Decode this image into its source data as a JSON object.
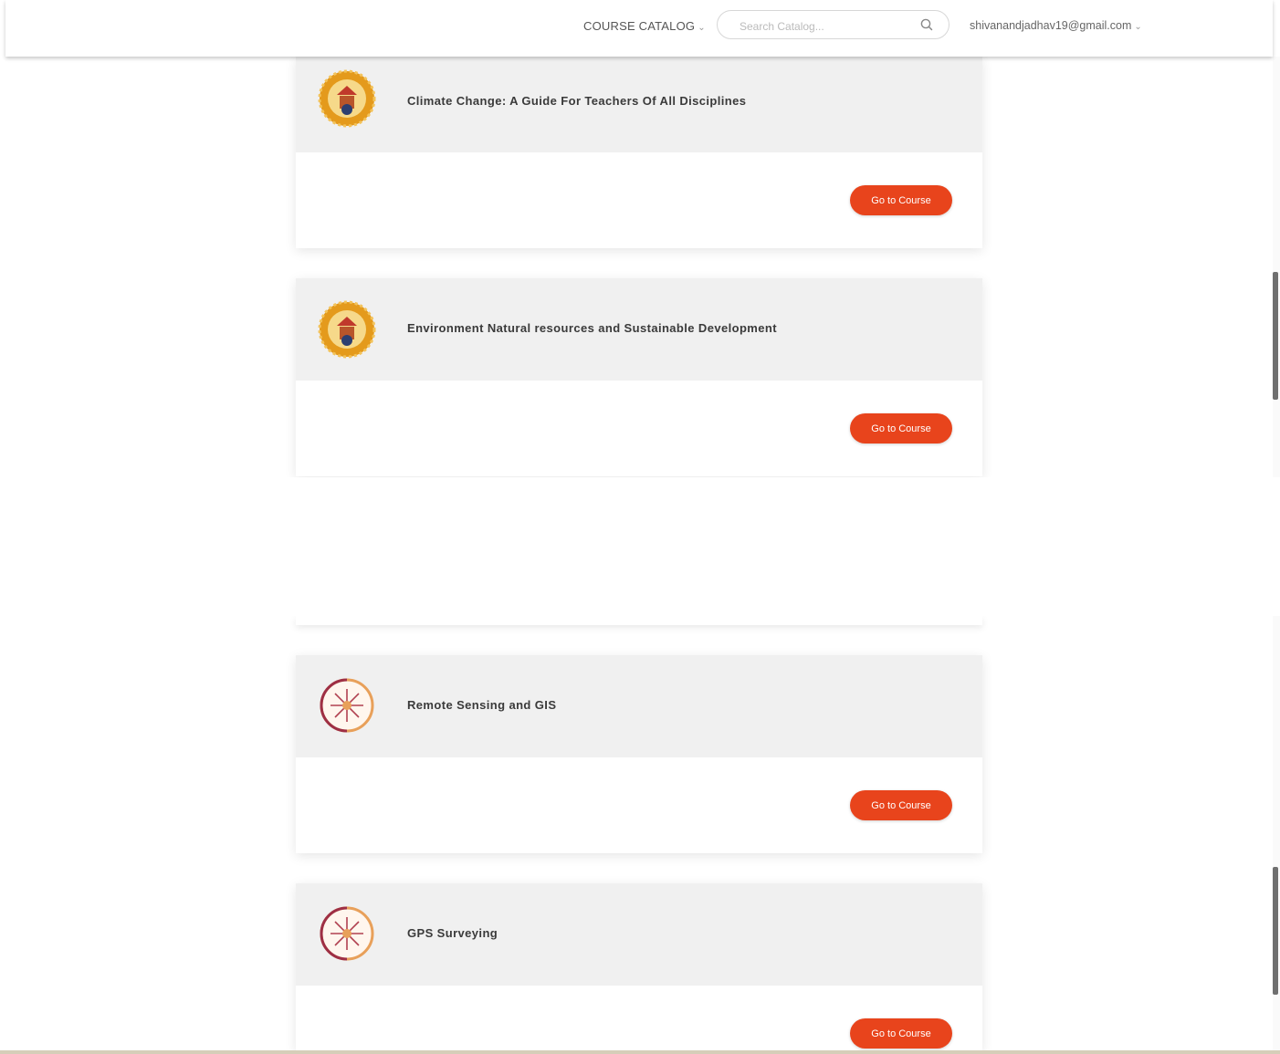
{
  "header": {
    "catalog_label": "COURSE CATALOG",
    "search_placeholder": "Search Catalog...",
    "user_email": "shivanandjadhav19@gmail.com"
  },
  "courses": [
    {
      "title": "Climate Change: A Guide For Teachers Of All Disciplines",
      "button_label": "Go to Course",
      "logo": "aicte-logo"
    },
    {
      "title": "Environment Natural resources and Sustainable Development",
      "button_label": "Go to Course",
      "logo": "aicte-logo"
    },
    {
      "title": "Remote Sensing and GIS",
      "button_label": "Go to Course",
      "logo": "compass-rose-logo"
    },
    {
      "title": "GPS Surveying",
      "button_label": "Go to Course",
      "logo": "compass-rose-logo"
    }
  ],
  "colors": {
    "accent": "#e8441c",
    "card_header_bg": "#f0f0f0",
    "logo_orange": "#e49a1c",
    "logo_maroon": "#9e2f45"
  }
}
